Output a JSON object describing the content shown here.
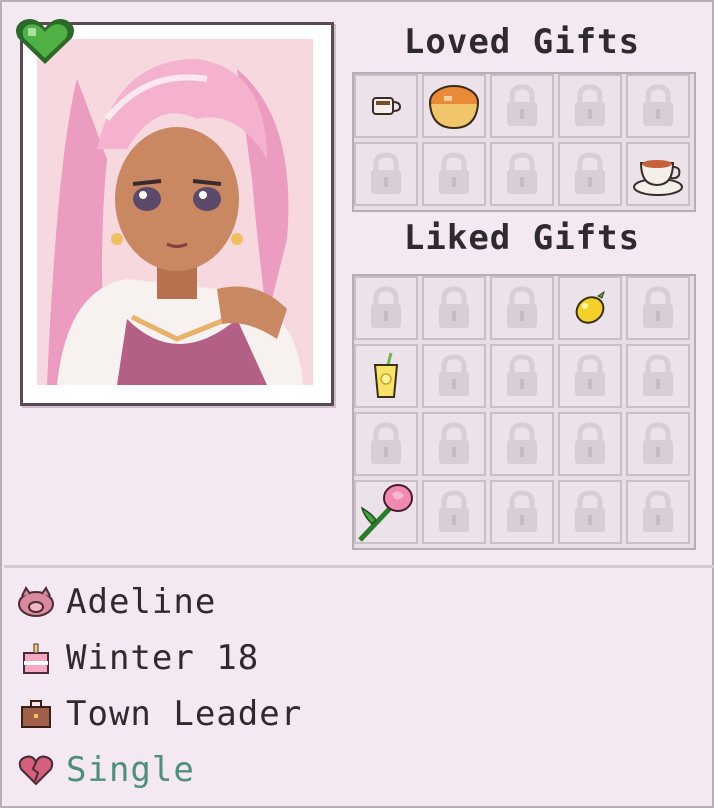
{
  "character": {
    "name": "Adeline",
    "birthday": "Winter 18",
    "occupation": "Town Leader",
    "relationship": "Single"
  },
  "loved_gifts": {
    "title": "Loved Gifts",
    "items": [
      "coffee-icon",
      "soup-bowl-icon",
      "lock-icon",
      "lock-icon",
      "lock-icon",
      "lock-icon",
      "lock-icon",
      "lock-icon",
      "lock-icon",
      "teacup-icon"
    ]
  },
  "liked_gifts": {
    "title": "Liked Gifts",
    "items": [
      "lock-icon",
      "lock-icon",
      "lock-icon",
      "lemon-icon",
      "lock-icon",
      "lemonade-icon",
      "lock-icon",
      "lock-icon",
      "lock-icon",
      "lock-icon",
      "lock-icon",
      "lock-icon",
      "lock-icon",
      "lock-icon",
      "lock-icon",
      "rose-icon",
      "lock-icon",
      "lock-icon",
      "lock-icon",
      "lock-icon"
    ]
  },
  "colors": {
    "panel": "#f4e8f2",
    "heart_green": "#3e9a3a",
    "status_text": "#4f8f79"
  }
}
